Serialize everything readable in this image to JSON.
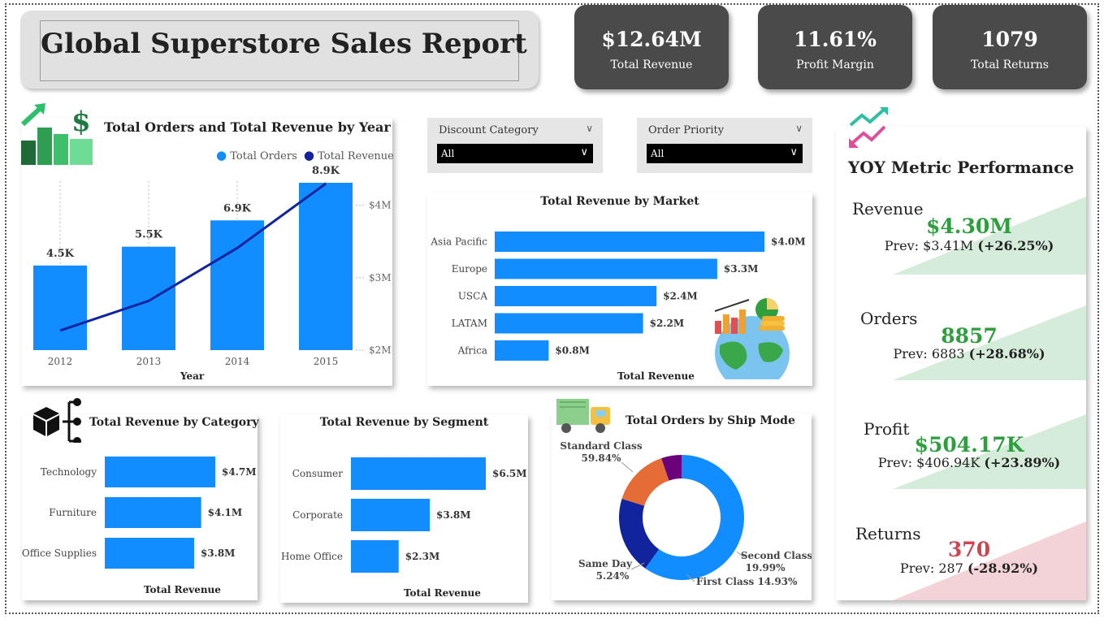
{
  "title": "Global Superstore Sales Report",
  "kpis": [
    {
      "value": "$12.64M",
      "label": "Total Revenue"
    },
    {
      "value": "11.61%",
      "label": "Profit Margin"
    },
    {
      "value": "1079",
      "label": "Total Returns"
    }
  ],
  "slicers": [
    {
      "label": "Discount Category",
      "value": "All"
    },
    {
      "label": "Order Priority",
      "value": "All"
    }
  ],
  "yoy": {
    "title": "YOY Metric Performance",
    "metrics": [
      {
        "name": "Revenue",
        "value": "$4.30M",
        "prev_label": "Prev:",
        "prev": "$3.41M",
        "change": "(+26.25%)",
        "color": "#2e9e3e",
        "bg": "#d4ecd9"
      },
      {
        "name": "Orders",
        "value": "8857",
        "prev_label": "Prev:",
        "prev": "6883",
        "change": "(+28.68%)",
        "color": "#2e9e3e",
        "bg": "#d4ecd9"
      },
      {
        "name": "Profit",
        "value": "$504.17K",
        "prev_label": "Prev:",
        "prev": "$406.94K",
        "change": "(+23.89%)",
        "color": "#2e9e3e",
        "bg": "#d4ecd9"
      },
      {
        "name": "Returns",
        "value": "370",
        "prev_label": "Prev:",
        "prev": "287",
        "change": "(-28.92%)",
        "color": "#d0434f",
        "bg": "#f3d3d8"
      }
    ]
  },
  "colors": {
    "bar": "#118dff",
    "line": "#12239e",
    "kpi_bg": "#4a4a4a",
    "second_class": "#12239e",
    "first_class": "#e66c37",
    "same_day": "#6b007b"
  },
  "chart_data": [
    {
      "id": "orders_revenue_by_year",
      "type": "bar",
      "title": "Total Orders and Total Revenue by Year",
      "xlabel": "Year",
      "categories": [
        "2012",
        "2013",
        "2014",
        "2015"
      ],
      "series": [
        {
          "name": "Total Orders",
          "type": "bar",
          "values": [
            4500,
            5500,
            6900,
            8900
          ],
          "labels": [
            "4.5K",
            "5.5K",
            "6.9K",
            "8.9K"
          ]
        },
        {
          "name": "Total Revenue",
          "type": "line",
          "axis": "secondary",
          "values": [
            2270000,
            2680000,
            3410000,
            4300000
          ]
        }
      ],
      "y2_ticks": [
        "$2M",
        "$3M",
        "$4M"
      ],
      "y2lim": [
        2000000,
        4300000
      ],
      "legend": "top-right"
    },
    {
      "id": "revenue_by_market",
      "type": "bar",
      "orientation": "horizontal",
      "title": "Total Revenue by Market",
      "xlabel": "Total Revenue",
      "categories": [
        "Asia Pacific",
        "Europe",
        "USCA",
        "LATAM",
        "Africa"
      ],
      "values": [
        4.0,
        3.3,
        2.4,
        2.2,
        0.8
      ],
      "labels": [
        "$4.0M",
        "$3.3M",
        "$2.4M",
        "$2.2M",
        "$0.8M"
      ]
    },
    {
      "id": "revenue_by_category",
      "type": "bar",
      "orientation": "horizontal",
      "title": "Total Revenue by Category",
      "xlabel": "Total Revenue",
      "categories": [
        "Technology",
        "Furniture",
        "Office Supplies"
      ],
      "values": [
        4.7,
        4.1,
        3.8
      ],
      "labels": [
        "$4.7M",
        "$4.1M",
        "$3.8M"
      ]
    },
    {
      "id": "revenue_by_segment",
      "type": "bar",
      "orientation": "horizontal",
      "title": "Total Revenue by Segment",
      "xlabel": "Total Revenue",
      "categories": [
        "Consumer",
        "Corporate",
        "Home Office"
      ],
      "values": [
        6.5,
        3.8,
        2.3
      ],
      "labels": [
        "$6.5M",
        "$3.8M",
        "$2.3M"
      ]
    },
    {
      "id": "orders_by_ship_mode",
      "type": "pie",
      "donut": true,
      "title": "Total Orders by Ship Mode",
      "slices": [
        {
          "name": "Standard Class",
          "value": 59.84,
          "label": "59.84%",
          "color": "#118dff"
        },
        {
          "name": "Second Class",
          "value": 19.99,
          "label": "19.99%",
          "color": "#12239e"
        },
        {
          "name": "First Class",
          "value": 14.93,
          "label": "14.93%",
          "color": "#e66c37"
        },
        {
          "name": "Same Day",
          "value": 5.24,
          "label": "5.24%",
          "color": "#6b007b"
        }
      ]
    }
  ]
}
